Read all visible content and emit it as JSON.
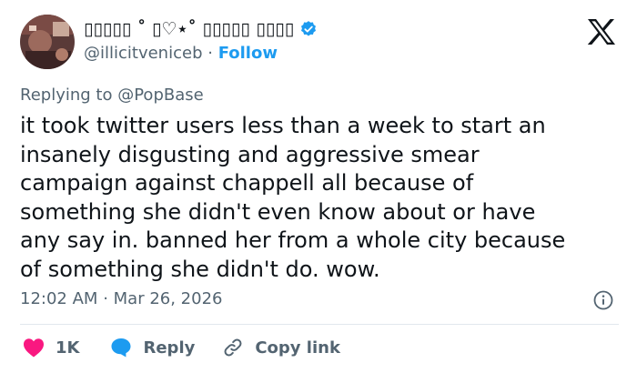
{
  "author": {
    "display_name": "▯▯▯▯▯ ˚ ▯♡⋆˚ ▯▯▯▯▯ ▯▯▯▯",
    "handle": "@illicitveniceb",
    "separator": "·",
    "follow_label": "Follow"
  },
  "reply": {
    "prefix": "Replying to",
    "mention": "@PopBase"
  },
  "tweet": {
    "lines": [
      "it took twitter users less than a week to start an",
      "insanely disgusting and aggressive smear",
      "campaign against chappell all because of",
      "something she didn't even know about or have",
      "any say in. banned her from a whole city because",
      "of something she didn't do. wow."
    ],
    "time": "12:02 AM",
    "separator": "·",
    "date": "Mar 26, 2026"
  },
  "actions": {
    "like_count": "1K",
    "reply_label": "Reply",
    "copy_link_label": "Copy link"
  },
  "colors": {
    "like": "#f91880",
    "link": "#1d9bf0",
    "muted": "#536471"
  },
  "icons": [
    "verified-icon",
    "x-logo-icon",
    "info-icon",
    "heart-icon",
    "reply-bubble-icon",
    "link-icon"
  ]
}
